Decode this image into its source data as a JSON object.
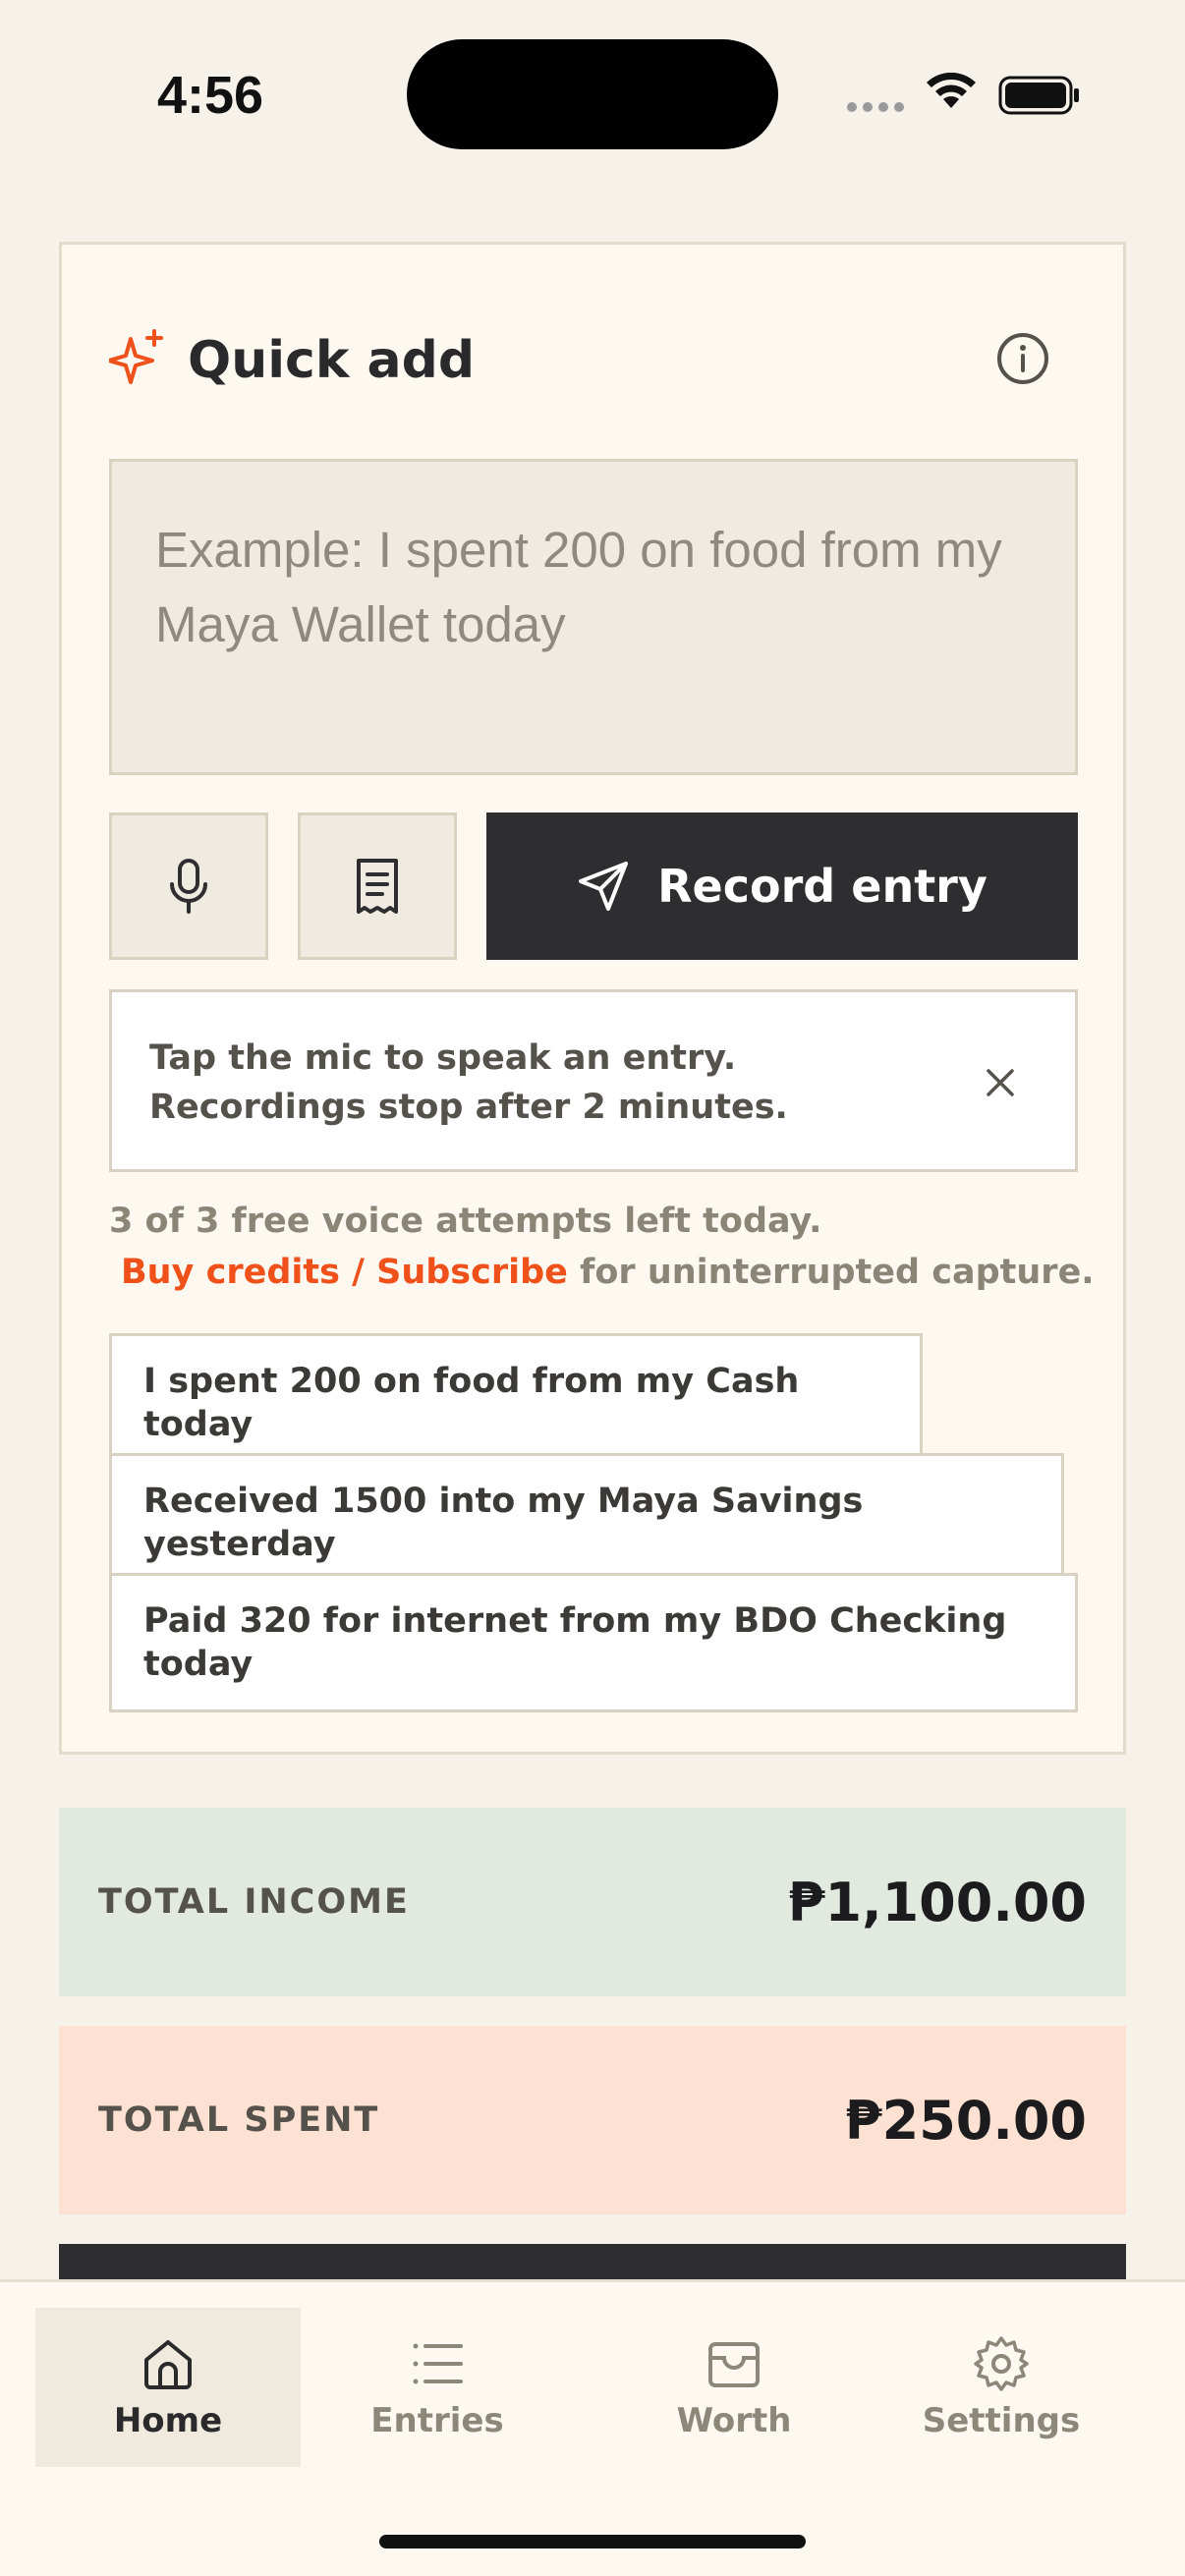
{
  "status_bar": {
    "time": "4:56"
  },
  "quick_add": {
    "title": "Quick add",
    "placeholder": "Example: I spent 200 on food from my Maya Wallet today",
    "record_label": "Record entry",
    "hint_line1": "Tap the mic to speak an entry.",
    "hint_line2": "Recordings stop after 2 minutes.",
    "attempts_text": "3 of 3 free voice attempts left today.",
    "buy_link": "Buy credits / Subscribe",
    "buy_suffix": " for uninterrupted capture.",
    "suggestions": [
      "I spent 200 on food from my Cash today",
      "Received 1500 into my Maya Savings yesterday",
      "Paid 320 for internet from my BDO Checking today"
    ]
  },
  "totals": {
    "income_label": "TOTAL INCOME",
    "income_value": "₱1,100.00",
    "spent_label": "TOTAL SPENT",
    "spent_value": "₱250.00"
  },
  "tabs": [
    {
      "label": "Home",
      "icon": "home-icon",
      "active": true
    },
    {
      "label": "Entries",
      "icon": "list-icon",
      "active": false
    },
    {
      "label": "Worth",
      "icon": "wallet-icon",
      "active": false
    },
    {
      "label": "Settings",
      "icon": "gear-icon",
      "active": false
    }
  ],
  "colors": {
    "accent": "#f0511b",
    "dark": "#2e2e30",
    "income_bg": "#e2e9de",
    "spent_bg": "#fde2d4"
  }
}
